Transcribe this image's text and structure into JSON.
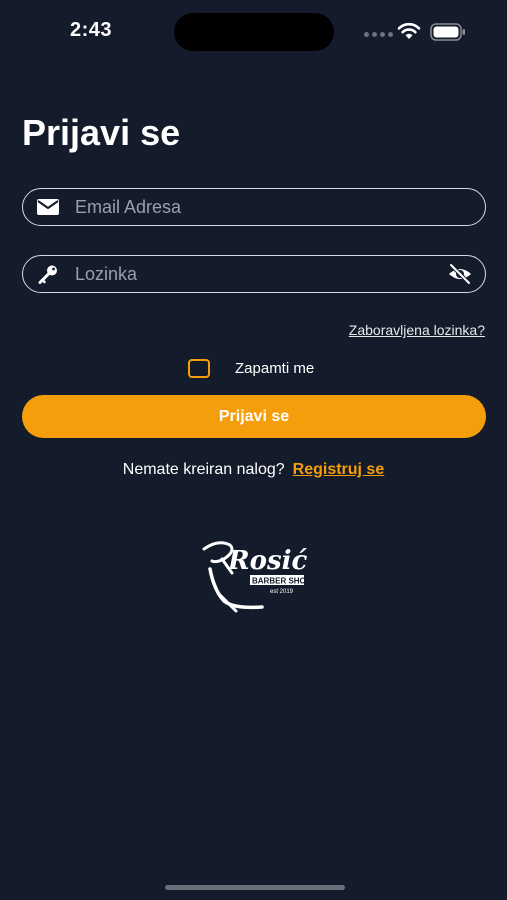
{
  "status_bar": {
    "time": "2:43"
  },
  "colors": {
    "background": "#141b2a",
    "accent": "#f59e0b",
    "text": "#ffffff",
    "border": "#d6d8de",
    "placeholder": "#9aa0aa"
  },
  "login": {
    "title": "Prijavi se",
    "email": {
      "placeholder": "Email Adresa",
      "value": "",
      "icon": "envelope-icon"
    },
    "password": {
      "placeholder": "Lozinka",
      "value": "",
      "icon": "key-icon",
      "toggle_icon": "eye-off-icon"
    },
    "forgot_password": "Zaboravljena lozinka?",
    "remember_me": {
      "label": "Zapamti me",
      "checked": false
    },
    "submit_label": "Prijavi se",
    "register_prompt": "Nemate kreiran nalog?",
    "register_link": "Registruj se"
  },
  "logo": {
    "brand": "Rosić",
    "tagline": "BARBER SHOP",
    "est": "est 2019"
  }
}
